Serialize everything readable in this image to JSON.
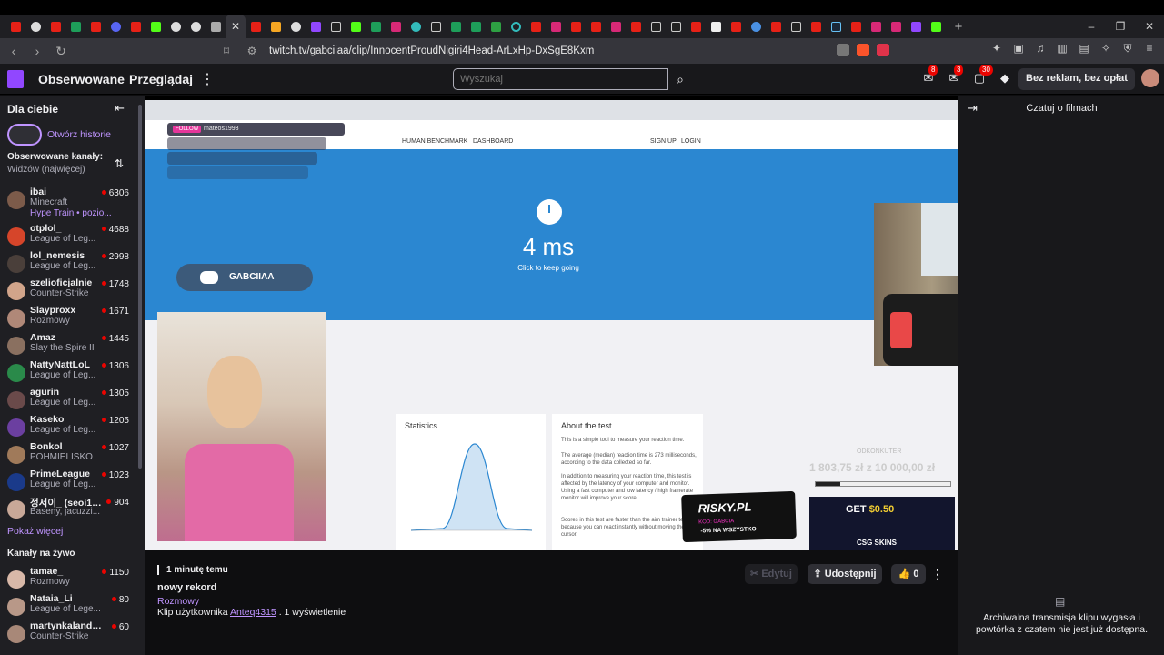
{
  "browser": {
    "active_tab_close": "✕",
    "new_tab": "+",
    "url": "twitch.tv/gabciiaa/clip/InnocentProudNigiri4Head-ArLxHp-DxSgE8Kxm",
    "window_controls": [
      "–",
      "❐",
      "✕"
    ]
  },
  "twitch_header": {
    "following": "Obserwowane",
    "browse": "Przeglądaj",
    "search_placeholder": "Wyszukaj",
    "badges": {
      "notifications": "8",
      "inbox": "3",
      "whispers": "30"
    },
    "no_ads": "Bez reklam, bez opłat"
  },
  "sidebar": {
    "title": "Dla ciebie",
    "story_label": "Otwórz historie",
    "followed_title": "Obserwowane kanały:",
    "followed_sort": "Widzów (najwięcej)",
    "hype_train": "Hype Train • pozio...",
    "channels": [
      {
        "name": "ibai",
        "game": "Minecraft",
        "viewers": "6306",
        "color": "#7c5b4a"
      },
      {
        "name": "otplol_",
        "game": "League of Leg...",
        "viewers": "4688",
        "color": "#d6452a"
      },
      {
        "name": "lol_nemesis",
        "game": "League of Leg...",
        "viewers": "2998",
        "color": "#4a3f3a"
      },
      {
        "name": "szelioficjalnie",
        "game": "Counter-Strike",
        "viewers": "1748",
        "color": "#d1a48a"
      },
      {
        "name": "Slayproxx",
        "game": "Rozmowy",
        "viewers": "1671",
        "color": "#b08878"
      },
      {
        "name": "Amaz",
        "game": "Slay the Spire II",
        "viewers": "1445",
        "color": "#8a7060"
      },
      {
        "name": "NattyNattLoL",
        "game": "League of Leg...",
        "viewers": "1306",
        "color": "#2a8a4a"
      },
      {
        "name": "agurin",
        "game": "League of Leg...",
        "viewers": "1305",
        "color": "#6a4a4a"
      },
      {
        "name": "Kaseko",
        "game": "League of Leg...",
        "viewers": "1205",
        "color": "#6b3fa0"
      },
      {
        "name": "Bonkol",
        "game": "POHMIELISKO",
        "viewers": "1027",
        "color": "#a07a5a"
      },
      {
        "name": "PrimeLeague",
        "game": "League of Leg...",
        "viewers": "1023",
        "color": "#1a3a8a"
      },
      {
        "name": "정서이_ (seoi10...",
        "game": "Baseny, jacuzzi...",
        "viewers": "904",
        "color": "#c8a898"
      }
    ],
    "show_more": "Pokaż więcej",
    "live_title": "Kanały na żywo",
    "live_channels": [
      {
        "name": "tamae_",
        "game": "Rozmowy",
        "viewers": "1150",
        "color": "#d8b8a8"
      },
      {
        "name": "Nataia_Li",
        "game": "League of Lege...",
        "viewers": "80",
        "color": "#b89888"
      },
      {
        "name": "martynkalandry...",
        "game": "Counter-Strike",
        "viewers": "60",
        "color": "#a88878"
      }
    ]
  },
  "video": {
    "follow_tag": "FOLLOW",
    "follow_user": "mateos1993",
    "nav_left": "HUMAN BENCHMARK",
    "nav_dash": "DASHBOARD",
    "nav_signup": "SIGN UP",
    "nav_login": "LOGIN",
    "result": "4 ms",
    "result_sub": "Click to keep going",
    "discord_label": "GABCIIAA",
    "stats_title": "Statistics",
    "about_title": "About the test",
    "about_lines": [
      "This is a simple tool to measure your reaction time.",
      "The average (median) reaction time is 273 milliseconds, according to the data collected so far.",
      "In addition to measuring your reaction time, this test is affected by the latency of your computer and monitor. Using a fast computer and low latency / high framerate monitor will improve your score.",
      "Scores in this test are faster than the aim trainer test, because you can react instantly without moving the cursor."
    ],
    "risky_brand": "RISKY.PL",
    "risky_code": "KOD: GABCIA",
    "risky_promo": "-5% NA WSZYSTKO",
    "counter_label": "ODKONKUTER",
    "counter_value": "1 803,75 zł z 10 000,00 zł",
    "counter_progress": 0.18,
    "csgo_get": "GET",
    "csgo_amount": "$0.50",
    "csgo_brand": "CSG SKINS"
  },
  "clip": {
    "time": "1 minutę temu",
    "title": "nowy rekord",
    "category": "Rozmowy",
    "by_prefix": "Klip użytkownika",
    "by_user": "Anteq4315",
    "views": ". 1 wyświetlenie",
    "edit": "Edytuj",
    "share": "Udostępnij",
    "likes": "0"
  },
  "chat": {
    "title": "Czatuj o filmach",
    "message": "Archiwalna transmisja klipu wygasła i powtórka z czatem nie jest już dostępna."
  }
}
